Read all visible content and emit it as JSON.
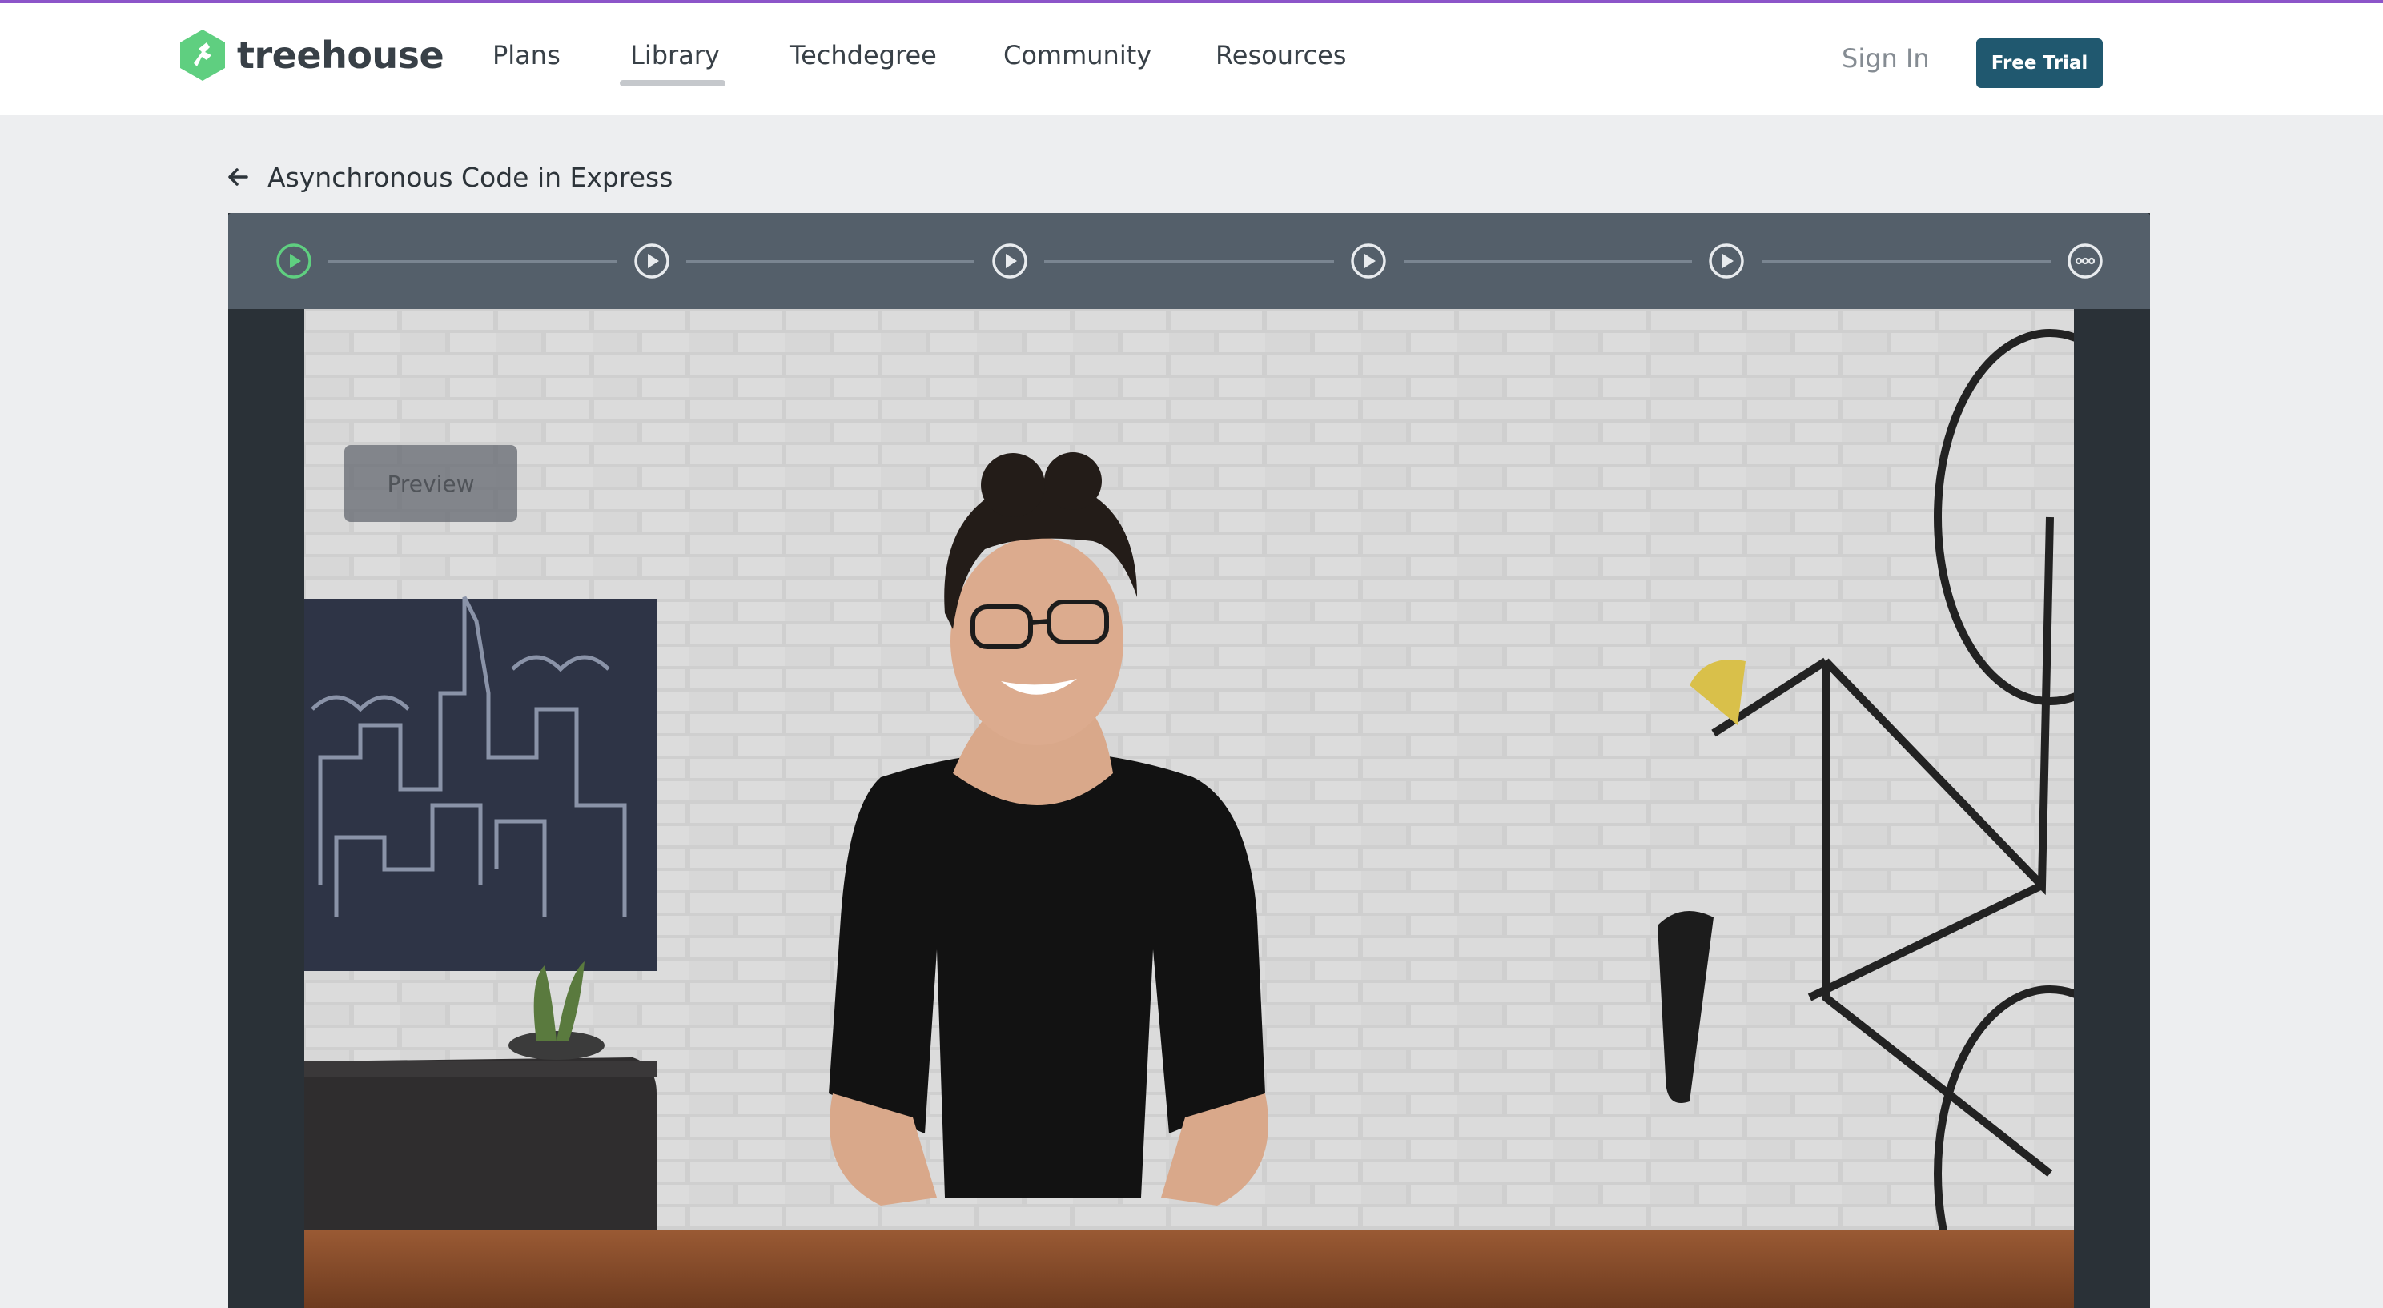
{
  "brand": {
    "name": "treehouse",
    "logo_color": "#5fcf80",
    "accent_color": "#8c55c9"
  },
  "nav": {
    "items": [
      {
        "label": "Plans"
      },
      {
        "label": "Library",
        "active": true
      },
      {
        "label": "Techdegree"
      },
      {
        "label": "Community"
      },
      {
        "label": "Resources"
      }
    ],
    "sign_in": "Sign In",
    "free_trial": "Free Trial",
    "free_trial_color": "#20586f"
  },
  "course": {
    "back_icon": "arrow-left-icon",
    "title": "Asynchronous Code in Express"
  },
  "progress": {
    "steps": [
      {
        "type": "video",
        "icon": "play-circle-icon",
        "current": true
      },
      {
        "type": "video",
        "icon": "play-circle-icon"
      },
      {
        "type": "video",
        "icon": "play-circle-icon"
      },
      {
        "type": "video",
        "icon": "play-circle-icon"
      },
      {
        "type": "video",
        "icon": "play-circle-icon"
      },
      {
        "type": "more",
        "icon": "ellipsis-circle-icon"
      }
    ],
    "current_color": "#5fcf80"
  },
  "video": {
    "preview_label": "Preview"
  }
}
